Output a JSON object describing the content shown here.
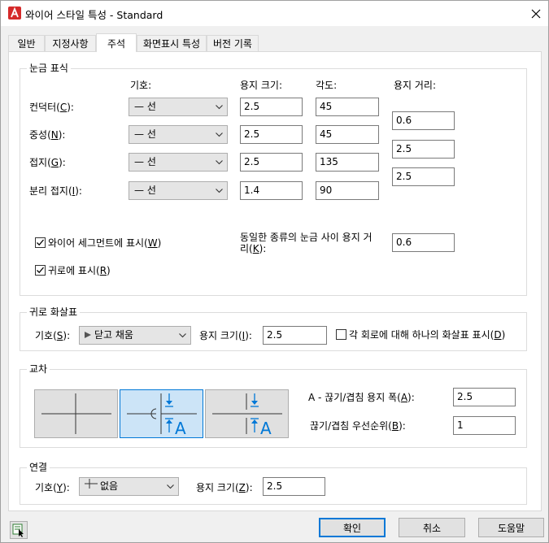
{
  "window": {
    "title": "와이어 스타일 특성 - Standard"
  },
  "tabs": [
    {
      "label": "일반"
    },
    {
      "label": "지정사항"
    },
    {
      "label": "주석"
    },
    {
      "label": "화면표시 특성"
    },
    {
      "label": "버전 기록"
    }
  ],
  "tick_marks": {
    "group_title": "눈금 표식",
    "col_symbol": "기호:",
    "col_paper_size": "용지 크기:",
    "col_angle": "각도:",
    "col_paper_distance": "용지 거리:",
    "rows": [
      {
        "label_pre": "컨덕터(",
        "label_key": "C",
        "label_post": "):",
        "symbol": "— 선",
        "size": "2.5",
        "angle": "45",
        "distance": "0.6"
      },
      {
        "label_pre": "중성(",
        "label_key": "N",
        "label_post": "):",
        "symbol": "— 선",
        "size": "2.5",
        "angle": "45",
        "distance": "2.5"
      },
      {
        "label_pre": "접지(",
        "label_key": "G",
        "label_post": "):",
        "symbol": "— 선",
        "size": "2.5",
        "angle": "135",
        "distance": "2.5"
      },
      {
        "label_pre": "분리 접지(",
        "label_key": "I",
        "label_post": "):",
        "symbol": "— 선",
        "size": "1.4",
        "angle": "90",
        "distance": ""
      }
    ],
    "show_on_segments": {
      "pre": "와이어 세그먼트에 표시(",
      "key": "W",
      "post": ")",
      "checked": true
    },
    "show_on_homeruns": {
      "pre": "귀로에 표시(",
      "key": "R",
      "post": ")",
      "checked": true
    },
    "same_type_spacing": {
      "line1": "동일한 종류의 눈금 사이 용지 거",
      "line2_pre": "리(",
      "key": "K",
      "line2_post": "):",
      "value": "0.6"
    }
  },
  "homerun_arrows": {
    "group_title": "귀로 화살표",
    "symbol_pre": "기호(",
    "symbol_key": "S",
    "symbol_post": "):",
    "symbol_value": "닫고 채움",
    "size_pre": "용지 크기(",
    "size_key": "I",
    "size_post": "):",
    "size_value": "2.5",
    "per_circuit": {
      "pre": "각 회로에 대해 하나의 화살표 표시(",
      "key": "D",
      "post": ")",
      "checked": false
    }
  },
  "crossings": {
    "group_title": "교차",
    "styles": [
      {
        "id": "none"
      },
      {
        "id": "break",
        "selected": true
      },
      {
        "id": "gap"
      }
    ],
    "gap_width": {
      "pre": "A - 끊기/겹침 용지 폭(",
      "key": "A",
      "post": "):",
      "value": "2.5"
    },
    "priority": {
      "pre": "끊기/겹침 우선순위(",
      "key": "B",
      "post": "):",
      "value": "1"
    }
  },
  "connections": {
    "group_title": "연결",
    "symbol_pre": "기호(",
    "symbol_key": "Y",
    "symbol_post": "):",
    "symbol_value": "없음",
    "size_pre": "용지 크기(",
    "size_key": "Z",
    "size_post": "):",
    "size_value": "2.5"
  },
  "buttons": {
    "ok": "확인",
    "cancel": "취소",
    "help": "도움말"
  },
  "icons": [
    "autocad-app-icon",
    "close-icon",
    "chevron-down-icon",
    "checkmark-icon",
    "arrow-right-filled-icon",
    "line-cross-icon",
    "context-help-icon"
  ]
}
